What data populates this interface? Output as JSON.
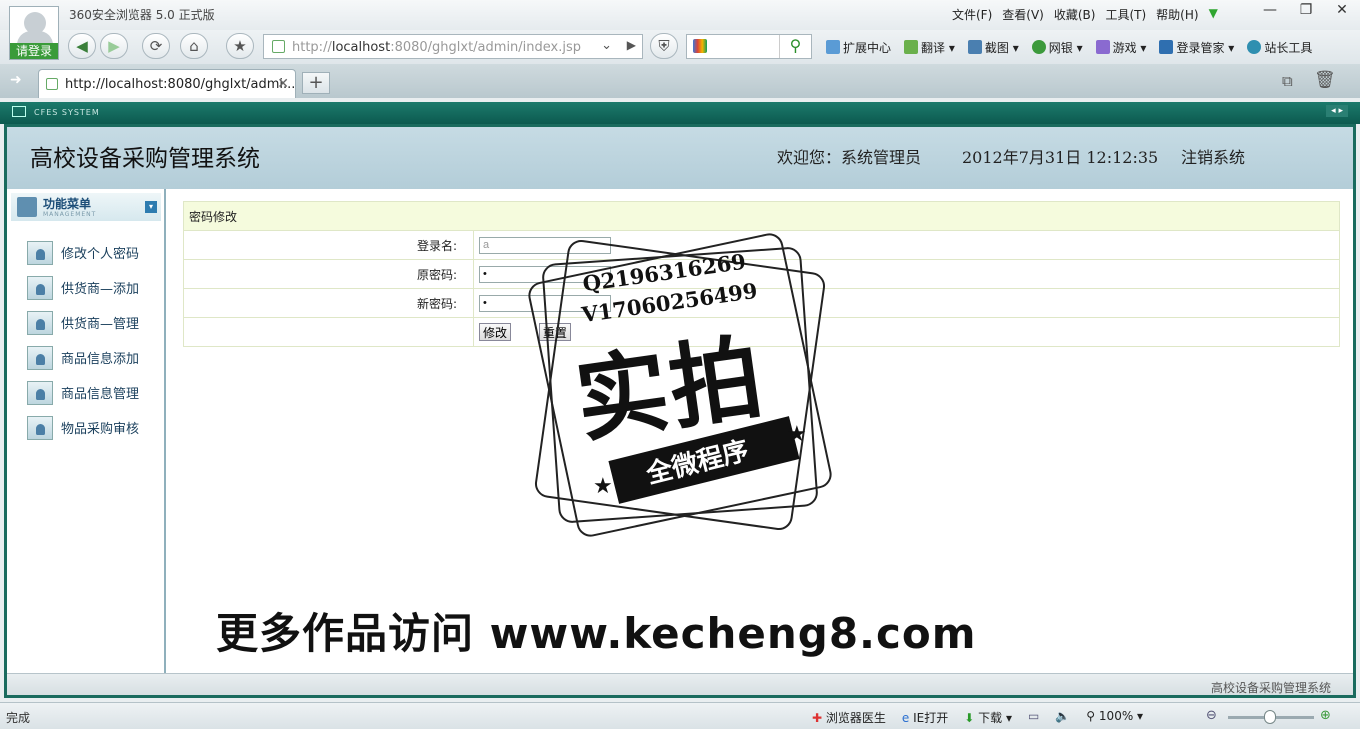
{
  "browser": {
    "title": "360安全浏览器 5.0 正式版",
    "login_badge": "请登录",
    "menu": [
      "文件(F)",
      "查看(V)",
      "收藏(B)",
      "工具(T)",
      "帮助(H)"
    ],
    "url_prefix": "http://",
    "url_host": "localhost",
    "url_rest": ":8080/ghglxt/admin/index.jsp",
    "extensions": [
      "扩展中心",
      "翻译",
      "截图",
      "网银",
      "游戏",
      "登录管家",
      "站长工具"
    ],
    "tab_title": "http://localhost:8080/ghglxt/admi...",
    "frame_label": "CFES SYSTEM"
  },
  "header": {
    "system_title": "高校设备采购管理系统",
    "welcome": "欢迎您：系统管理员",
    "datetime": "2012年7月31日  12:12:35",
    "logout": "注销系统"
  },
  "sidebar": {
    "title": "功能菜单",
    "subtitle": "MANAGEMENT",
    "items": [
      {
        "label": "修改个人密码"
      },
      {
        "label": "供货商—添加"
      },
      {
        "label": "供货商—管理"
      },
      {
        "label": "商品信息添加"
      },
      {
        "label": "商品信息管理"
      },
      {
        "label": "物品采购审核"
      }
    ]
  },
  "form": {
    "caption": "密码修改",
    "login_label": "登录名:",
    "login_value": "a",
    "old_label": "原密码:",
    "old_value": "•",
    "new_label": "新密码:",
    "new_value": "•",
    "submit": "修改",
    "reset": "重置"
  },
  "footer": {
    "text": "高校设备采购管理系统"
  },
  "watermark": {
    "line1": "Q2196316269",
    "line2": "V17060256499",
    "big": "实拍",
    "ribbon": "全微程序",
    "promo": "更多作品访问 www.kecheng8.com"
  },
  "status": {
    "done": "完成",
    "items": [
      "浏览器医生",
      "IE打开",
      "下载"
    ],
    "zoom": "100%"
  }
}
